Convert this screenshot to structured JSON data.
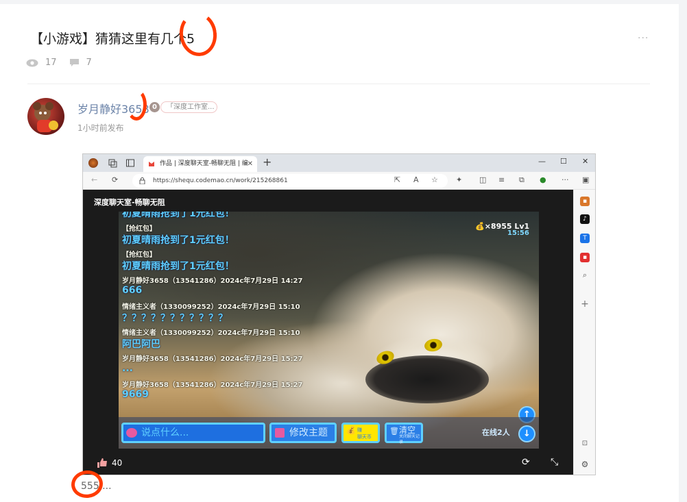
{
  "post": {
    "title": "【小游戏】猜猜这里有几个5",
    "views": "17",
    "comments": "7",
    "author": "岁月静好3658",
    "level": "0",
    "studio": "「深度工作室...",
    "time": "1小时前发布",
    "more_label": "···",
    "footer": "555...."
  },
  "browser": {
    "tab_title": "作品 | 深度聊天室-畅聊无阻 | 编",
    "tab_close": "✕",
    "new_tab": "+",
    "url": "https://shequ.codemao.cn/work/215268861",
    "win_min": "—",
    "win_max": "☐",
    "win_close": "✕"
  },
  "game": {
    "stage_title": "深度聊天室-畅聊无阻",
    "coins": "💰×8955  Lv1",
    "clock": "15:56",
    "messages": [
      {
        "meta": "",
        "body": "初夏晴雨抢到了1元红包！"
      },
      {
        "meta": "【抢红包】",
        "body": "初夏晴雨抢到了1元红包！"
      },
      {
        "meta": "【抢红包】",
        "body": "初夏晴雨抢到了1元红包！"
      },
      {
        "meta": "岁月静好3658（13541286）2024c年7月29日  14:27",
        "body": "666"
      },
      {
        "meta": "情绪主义者（1330099252）2024c年7月29日  15:10",
        "body": "？？？？？？？？？？？"
      },
      {
        "meta": "情绪主义者（1330099252）2024c年7月29日  15:10",
        "body": "阿巴阿巴"
      },
      {
        "meta": "岁月静好3658（13541286）2024c年7月29日  15:27",
        "body": "..."
      },
      {
        "meta": "岁月静好3658（13541286）2024c年7月29日  15:27",
        "body": "9669"
      }
    ],
    "say_placeholder": "说点什么...",
    "theme_button": "修改主题",
    "earn_line1": "赚",
    "earn_line2": "聊天币",
    "clear_label": "清空",
    "clear_sub": "关闭聊天记录",
    "online": "在线2人",
    "up_arrow": "↑",
    "down_arrow": "↓",
    "likes": "40"
  },
  "colors": {
    "accent_blue": "#5fd0ff",
    "highlight_mark": "#ff3b00",
    "author_link": "#6b83a8"
  }
}
